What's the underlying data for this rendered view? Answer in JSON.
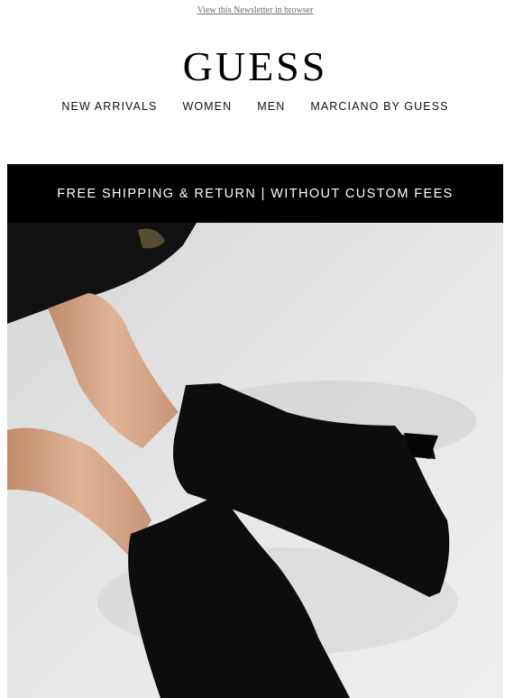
{
  "header": {
    "view_in_browser": "View this Newsletter in browser",
    "logo": "GUESS"
  },
  "nav": {
    "items": [
      "NEW ARRIVALS",
      "WOMEN",
      "MEN",
      "MARCIANO BY GUESS"
    ]
  },
  "banner": {
    "text": "FREE SHIPPING & RETURN | WITHOUT CUSTOM FEES"
  },
  "hero": {
    "subject": "black-suede-boots-photo",
    "background_color": "#e4e4e4",
    "boot_color": "#0d0d0d",
    "skin_color": "#d7a889"
  }
}
